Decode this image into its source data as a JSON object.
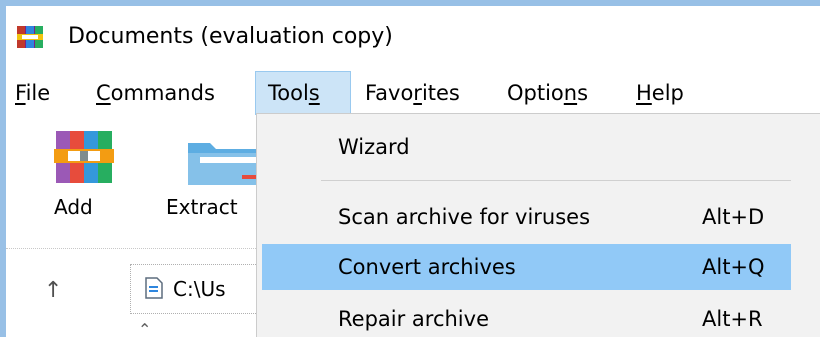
{
  "window": {
    "title": "Documents (evaluation copy)"
  },
  "menubar": {
    "items": [
      {
        "label": "File",
        "u": "F",
        "rest": "ile"
      },
      {
        "label": "Commands",
        "u": "C",
        "rest": "ommands"
      },
      {
        "label": "Tools",
        "pre": "Tool",
        "u": "s",
        "open": true
      },
      {
        "label": "Favorites",
        "pre": "Favo",
        "u": "r",
        "rest": "ites"
      },
      {
        "label": "Options",
        "pre": "Optio",
        "u": "n",
        "rest": "s"
      },
      {
        "label": "Help",
        "u": "H",
        "rest": "elp"
      }
    ]
  },
  "toolbar": {
    "add_label": "Add",
    "extract_label": "Extract",
    "path_text": "C:\\Us"
  },
  "tools_menu": {
    "items": [
      {
        "label": "Wizard",
        "shortcut": ""
      },
      {
        "label": "Scan archive for viruses",
        "shortcut": "Alt+D"
      },
      {
        "label": "Convert archives",
        "shortcut": "Alt+Q",
        "highlighted": true
      },
      {
        "label": "Repair archive",
        "shortcut": "Alt+R"
      }
    ]
  },
  "colors": {
    "frame": "#98c0e6",
    "menu_open_bg": "#cce4f7",
    "highlight": "#91c9f7",
    "dropdown_bg": "#f2f2f2"
  },
  "icons": [
    "winrar-app-icon",
    "add-archive-icon",
    "extract-folder-icon",
    "up-arrow-icon",
    "path-file-icon"
  ]
}
